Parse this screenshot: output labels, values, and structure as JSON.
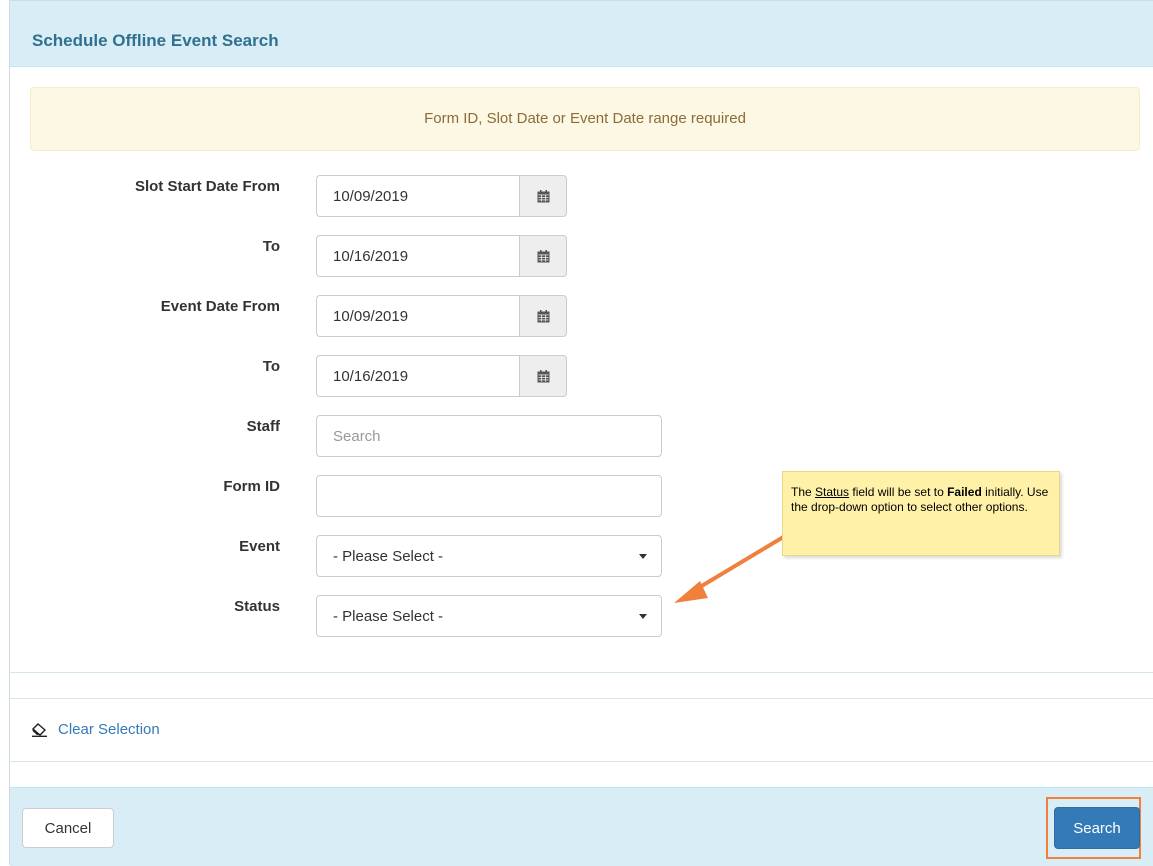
{
  "panel": {
    "title": "Schedule Offline Event Search"
  },
  "alert": {
    "message": "Form ID, Slot Date or Event Date range required"
  },
  "form": {
    "slot_start_from": {
      "label": "Slot Start Date From",
      "value": "10/09/2019"
    },
    "slot_start_to": {
      "label": "To",
      "value": "10/16/2019"
    },
    "event_date_from": {
      "label": "Event Date From",
      "value": "10/09/2019"
    },
    "event_date_to": {
      "label": "To",
      "value": "10/16/2019"
    },
    "staff": {
      "label": "Staff",
      "placeholder": "Search"
    },
    "form_id": {
      "label": "Form ID",
      "value": ""
    },
    "event": {
      "label": "Event",
      "selected": "- Please Select -"
    },
    "status": {
      "label": "Status",
      "selected": "- Please Select -"
    }
  },
  "callout": {
    "part1": "The ",
    "status_word": "Status",
    "part2": " field will be set to ",
    "failed_word": "Failed",
    "part3": " initially. Use the drop-down option to select other options.",
    "accent_color": "#f0803c",
    "background_color": "#fff1a8"
  },
  "clear_selection": {
    "label": "Clear Selection",
    "icon": "eraser-icon"
  },
  "footer": {
    "cancel_label": "Cancel",
    "search_label": "Search"
  },
  "colors": {
    "header_bg": "#d9edf7",
    "title_color": "#31708f",
    "alert_bg": "#fcf8e3",
    "alert_text": "#8a6d3b",
    "primary": "#337ab7",
    "highlight": "#f0803c"
  }
}
